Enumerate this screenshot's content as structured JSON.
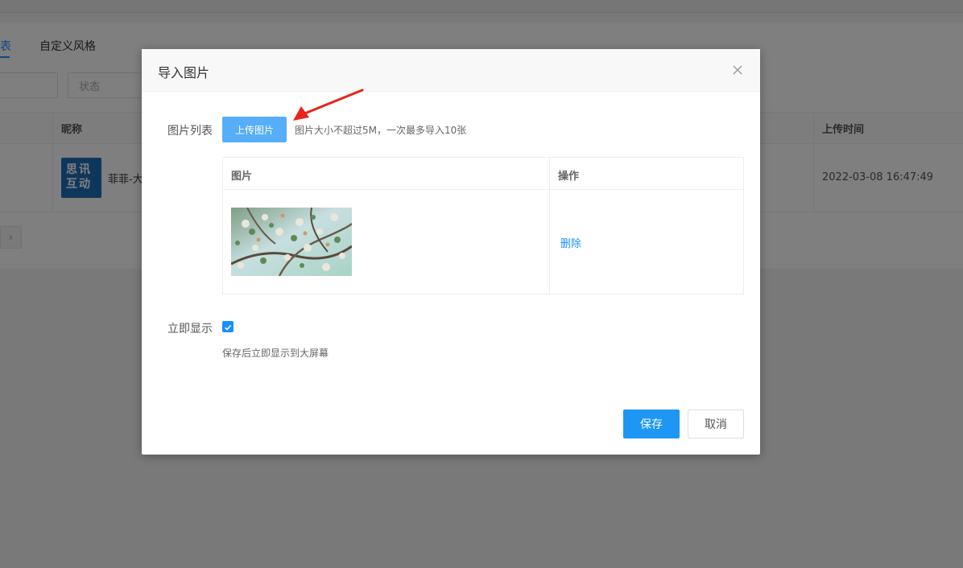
{
  "background": {
    "tabs": [
      "表",
      "自定义风格"
    ],
    "status_placeholder": "状态",
    "table": {
      "headers": {
        "nickname": "昵称",
        "upload_time": "上传时间"
      },
      "row": {
        "logo_line1": "思讯",
        "logo_line2": "互动",
        "name": "菲菲-大",
        "upload_time": "2022-03-08 16:47:49"
      }
    },
    "pager_next": "›",
    "accent_color": "#1890ff"
  },
  "dialog": {
    "title": "导入图片",
    "close_icon": "close-icon",
    "image_list_label": "图片列表",
    "upload_button": "上传图片",
    "upload_hint": "图片大小不超过5M，一次最多导入10张",
    "table": {
      "headers": [
        "图片",
        "操作"
      ],
      "rows": [
        {
          "image": "flower-thumbnail",
          "action": "删除"
        }
      ]
    },
    "show_now_label": "立即显示",
    "show_now_checked": true,
    "show_now_help": "保存后立即显示到大屏幕",
    "save_button": "保存",
    "cancel_button": "取消",
    "primary_color": "#1e96f3",
    "annotation": "red-arrow-icon"
  }
}
